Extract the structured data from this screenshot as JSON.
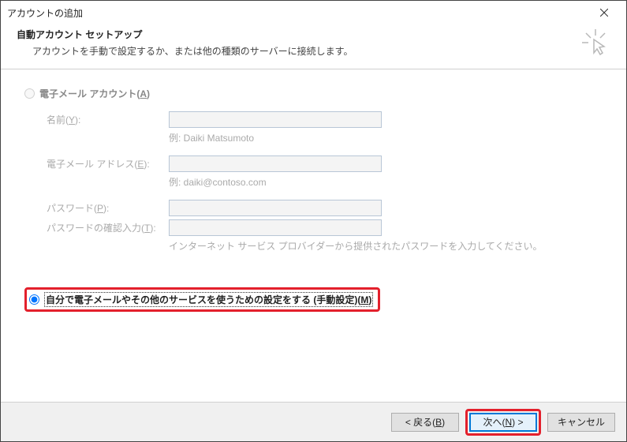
{
  "window": {
    "title": "アカウントの追加"
  },
  "header": {
    "heading": "自動アカウント セットアップ",
    "subtitle": "アカウントを手動で設定するか、または他の種類のサーバーに接続します。"
  },
  "options": {
    "email_account": {
      "label_prefix": "電子メール アカウント(",
      "accelerator": "A",
      "label_suffix": ")"
    },
    "manual": {
      "label_prefix": "自分で電子メールやその他のサービスを使うための設定をする (手動設定)(",
      "accelerator": "M",
      "label_suffix": ")"
    }
  },
  "fields": {
    "name": {
      "label_prefix": "名前(",
      "accelerator": "Y",
      "label_suffix": "):",
      "value": "",
      "hint": "例: Daiki Matsumoto"
    },
    "email": {
      "label_prefix": "電子メール アドレス(",
      "accelerator": "E",
      "label_suffix": "):",
      "value": "",
      "hint": "例: daiki@contoso.com"
    },
    "password": {
      "label_prefix": "パスワード(",
      "accelerator": "P",
      "label_suffix": "):",
      "value": ""
    },
    "password_confirm": {
      "label_prefix": "パスワードの確認入力(",
      "accelerator": "T",
      "label_suffix": "):",
      "value": ""
    },
    "isp_hint": "インターネット サービス プロバイダーから提供されたパスワードを入力してください。"
  },
  "buttons": {
    "back_prefix": "< 戻る(",
    "back_accel": "B",
    "back_suffix": ")",
    "next_prefix": "次へ(",
    "next_accel": "N",
    "next_suffix": ") >",
    "cancel": "キャンセル"
  }
}
